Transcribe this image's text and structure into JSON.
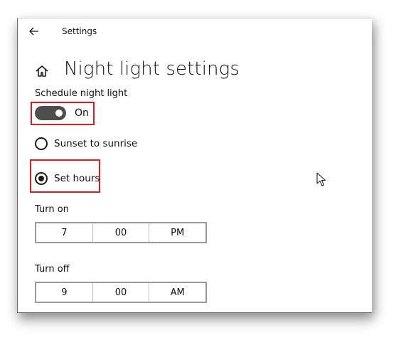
{
  "titlebar": {
    "back_icon": "back-arrow-icon",
    "app_title": "Settings"
  },
  "page": {
    "home_icon": "home-icon",
    "title": "Night light settings"
  },
  "schedule": {
    "label": "Schedule night light",
    "toggle_state": "On",
    "toggle_on": true
  },
  "options": {
    "sunset_label": "Sunset to sunrise",
    "set_hours_label": "Set hours",
    "selected": "Set hours"
  },
  "turn_on": {
    "label": "Turn on",
    "hour": "7",
    "minute": "00",
    "period": "PM"
  },
  "turn_off": {
    "label": "Turn off",
    "hour": "9",
    "minute": "00",
    "period": "AM"
  },
  "colors": {
    "highlight": "#e21b1b",
    "toggle_on": "#4d4d4d"
  }
}
